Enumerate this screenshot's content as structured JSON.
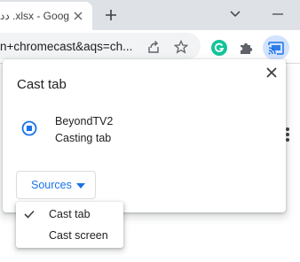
{
  "tab": {
    "title": "دد .xlsx - Goog",
    "close_icon": "close-icon"
  },
  "tabstrip": {
    "new_tab_icon": "plus-icon",
    "window_icons": [
      "chevron-down-icon",
      "minimize-icon"
    ]
  },
  "omnibox": {
    "url": "n+chromecast&aqs=ch...",
    "icons": [
      "share-icon",
      "star-icon"
    ]
  },
  "extensions": [
    "grammarly-icon",
    "puzzle-icon",
    "cast-icon"
  ],
  "colors": {
    "accent": "#1a73e8",
    "grammarly": "#15c39a",
    "cast_active_bg": "#d3e3fd"
  },
  "dialog": {
    "title": "Cast tab",
    "sink": {
      "name": "BeyondTV2",
      "status": "Casting tab"
    },
    "sources_label": "Sources"
  },
  "sources_menu": {
    "items": [
      {
        "label": "Cast tab",
        "checked": true
      },
      {
        "label": "Cast screen",
        "checked": false
      }
    ]
  }
}
